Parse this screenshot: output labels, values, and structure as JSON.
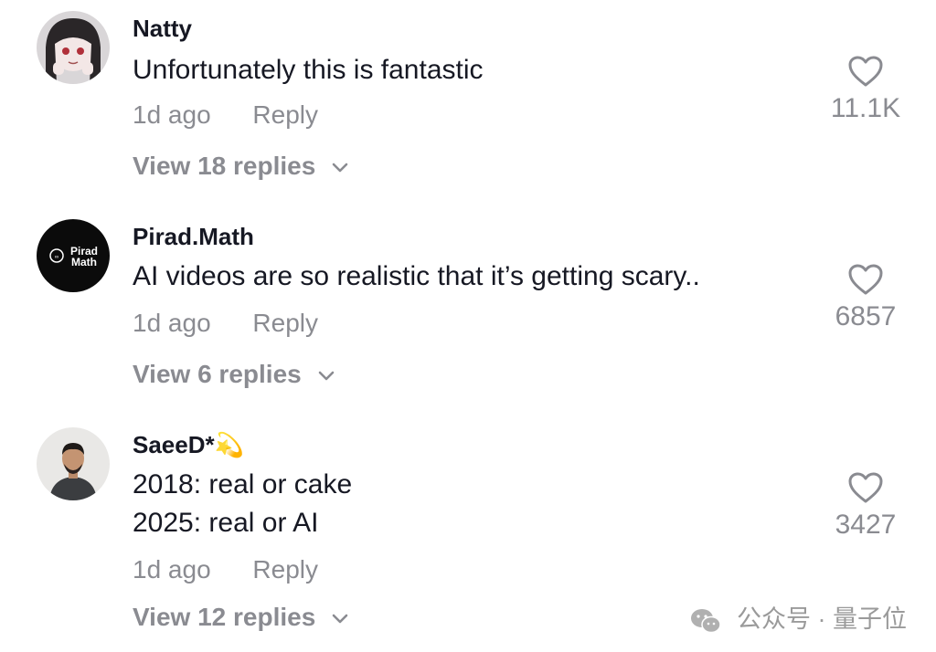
{
  "comments": [
    {
      "username": "Natty",
      "text_lines": [
        "Unfortunately this is fantastic"
      ],
      "time": "1d ago",
      "reply_label": "Reply",
      "view_replies": "View 18 replies",
      "likes": "11.1K"
    },
    {
      "username": "Pirad.Math",
      "text_lines": [
        "AI videos are so realistic that it’s getting scary.."
      ],
      "time": "1d ago",
      "reply_label": "Reply",
      "view_replies": "View 6 replies",
      "likes": "6857",
      "avatar_text": [
        "Pirad",
        "Math"
      ]
    },
    {
      "username": "SaeeD*💫",
      "text_lines": [
        "2018: real or cake",
        "2025: real or AI"
      ],
      "time": "1d ago",
      "reply_label": "Reply",
      "view_replies": "View 12 replies",
      "likes": "3427"
    }
  ],
  "watermark": "公众号 · 量子位",
  "icons": {
    "like": "heart-outline-icon",
    "expand": "chevron-down-icon",
    "watermark": "wechat-icon"
  },
  "colors": {
    "primary_text": "#161823",
    "secondary_text": "#8a8b91"
  }
}
